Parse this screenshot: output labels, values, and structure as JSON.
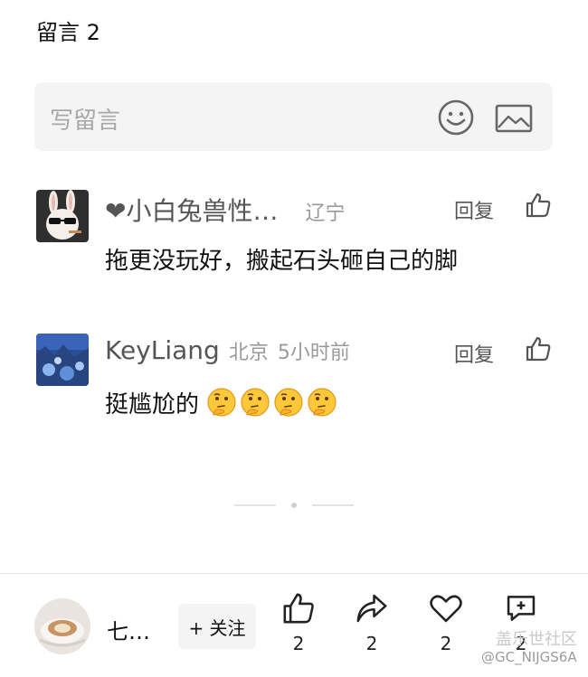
{
  "header": {
    "title": "留言 2"
  },
  "compose": {
    "placeholder": "写留言",
    "emoji_icon": "emoji-icon",
    "image_icon": "image-icon"
  },
  "comments": [
    {
      "username": "❤小白兔兽性…",
      "location": "辽宁",
      "time": "",
      "reply_label": "回复",
      "text": "拖更没玩好，搬起石头砸自己的脚",
      "emoji_count": 0
    },
    {
      "username": "KeyLiang",
      "location": "北京",
      "time": "5小时前",
      "reply_label": "回复",
      "text": "挺尴尬的",
      "emoji_count": 4
    }
  ],
  "bottom_bar": {
    "author_name": "七…",
    "follow_label": "+ 关注",
    "like_count": "2",
    "share_count": "2",
    "favorite_count": "2",
    "comment_count": "2"
  },
  "watermark": {
    "line1": "盖乐世社区",
    "line2": "@GC_NIJGS6A"
  },
  "colors": {
    "background": "#ffffff",
    "input_bg": "#f4f4f4",
    "text": "#111111",
    "muted": "#9a9a9a"
  }
}
